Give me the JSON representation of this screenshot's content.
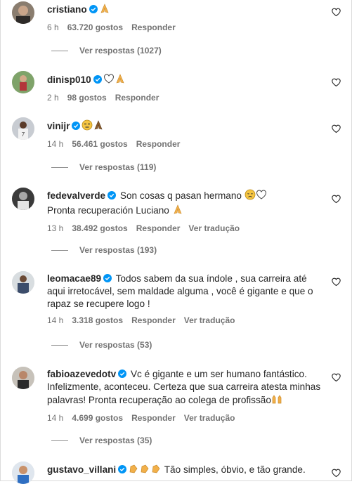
{
  "comments": [
    {
      "username": "cristiano",
      "text": "",
      "time": "6 h",
      "likes": "63.720 gostos",
      "reply": "Responder",
      "translate": "",
      "view_replies": "Ver respostas (1027)"
    },
    {
      "username": "dinisp010",
      "text": "",
      "time": "2 h",
      "likes": "98 gostos",
      "reply": "Responder",
      "translate": "",
      "view_replies": ""
    },
    {
      "username": "vinijr",
      "text": "",
      "time": "14 h",
      "likes": "56.461 gostos",
      "reply": "Responder",
      "translate": "",
      "view_replies": "Ver respostas (119)"
    },
    {
      "username": "fedevalverde",
      "text": "Son cosas q pasan hermano",
      "text2": "Pronta recuperación Luciano",
      "time": "13 h",
      "likes": "38.492 gostos",
      "reply": "Responder",
      "translate": "Ver tradução",
      "view_replies": "Ver respostas (193)"
    },
    {
      "username": "leomacae89",
      "text_lines": [
        "Todos sabem da sua índole , sua carreira até",
        "aqui irretocável, sem maldade alguma , você é gigante e que o",
        "rapaz se recupere logo !"
      ],
      "time": "14 h",
      "likes": "3.318 gostos",
      "reply": "Responder",
      "translate": "Ver tradução",
      "view_replies": "Ver respostas (53)"
    },
    {
      "username": "fabioazevedotv",
      "text_lines": [
        "Vc é gigante e um ser humano fantástico.",
        "Infelizmente, aconteceu. Certeza que sua carreira atesta minhas",
        "palavras! Pronta recuperação ao colega de profissão"
      ],
      "time": "14 h",
      "likes": "4.699 gostos",
      "reply": "Responder",
      "translate": "Ver tradução",
      "view_replies": "Ver respostas (35)"
    },
    {
      "username": "gustavo_villani",
      "text": "Tão simples, óbvio, e tão grande.",
      "time": "",
      "likes": "",
      "reply": "",
      "translate": "",
      "view_replies": ""
    }
  ],
  "colors": {
    "verified": "#0095f6",
    "text": "#262626",
    "muted": "#737373"
  },
  "icons": [
    "verified-badge-icon",
    "heart-outline-icon",
    "praying-hands-emoji",
    "white-heart-emoji",
    "disappointed-face-emoji",
    "clapping-hands-emoji",
    "raised-hands-emoji",
    "unamused-face-emoji"
  ]
}
